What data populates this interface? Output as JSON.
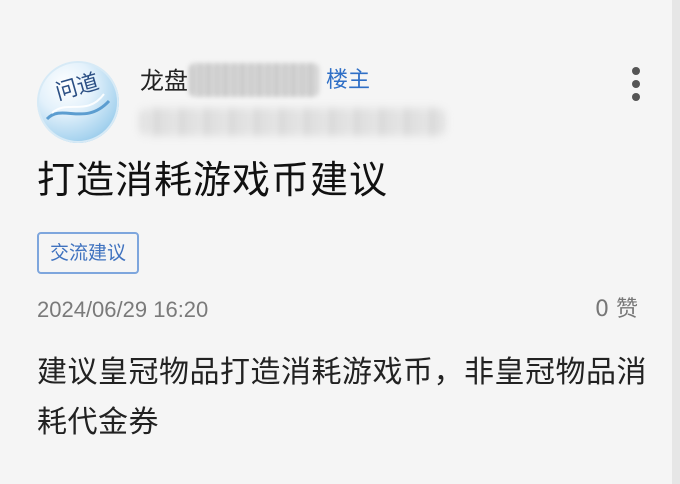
{
  "post": {
    "author_prefix": "龙盘",
    "owner_badge": "楼主",
    "title": "打造消耗游戏币建议",
    "tag": "交流建议",
    "date": "2024/06/29 16:20",
    "likes": "0 赞",
    "body": "建议皇冠物品打造消耗游戏币，非皇冠物品消耗代金券"
  },
  "avatar": {
    "glyphs": "问道"
  },
  "colors": {
    "background": "#f5f5f5",
    "owner_badge": "#2f6fc6",
    "tag_border": "#7ea6dd",
    "tag_text": "#3f72bf"
  },
  "icons": {
    "more": "more-vertical-icon"
  }
}
